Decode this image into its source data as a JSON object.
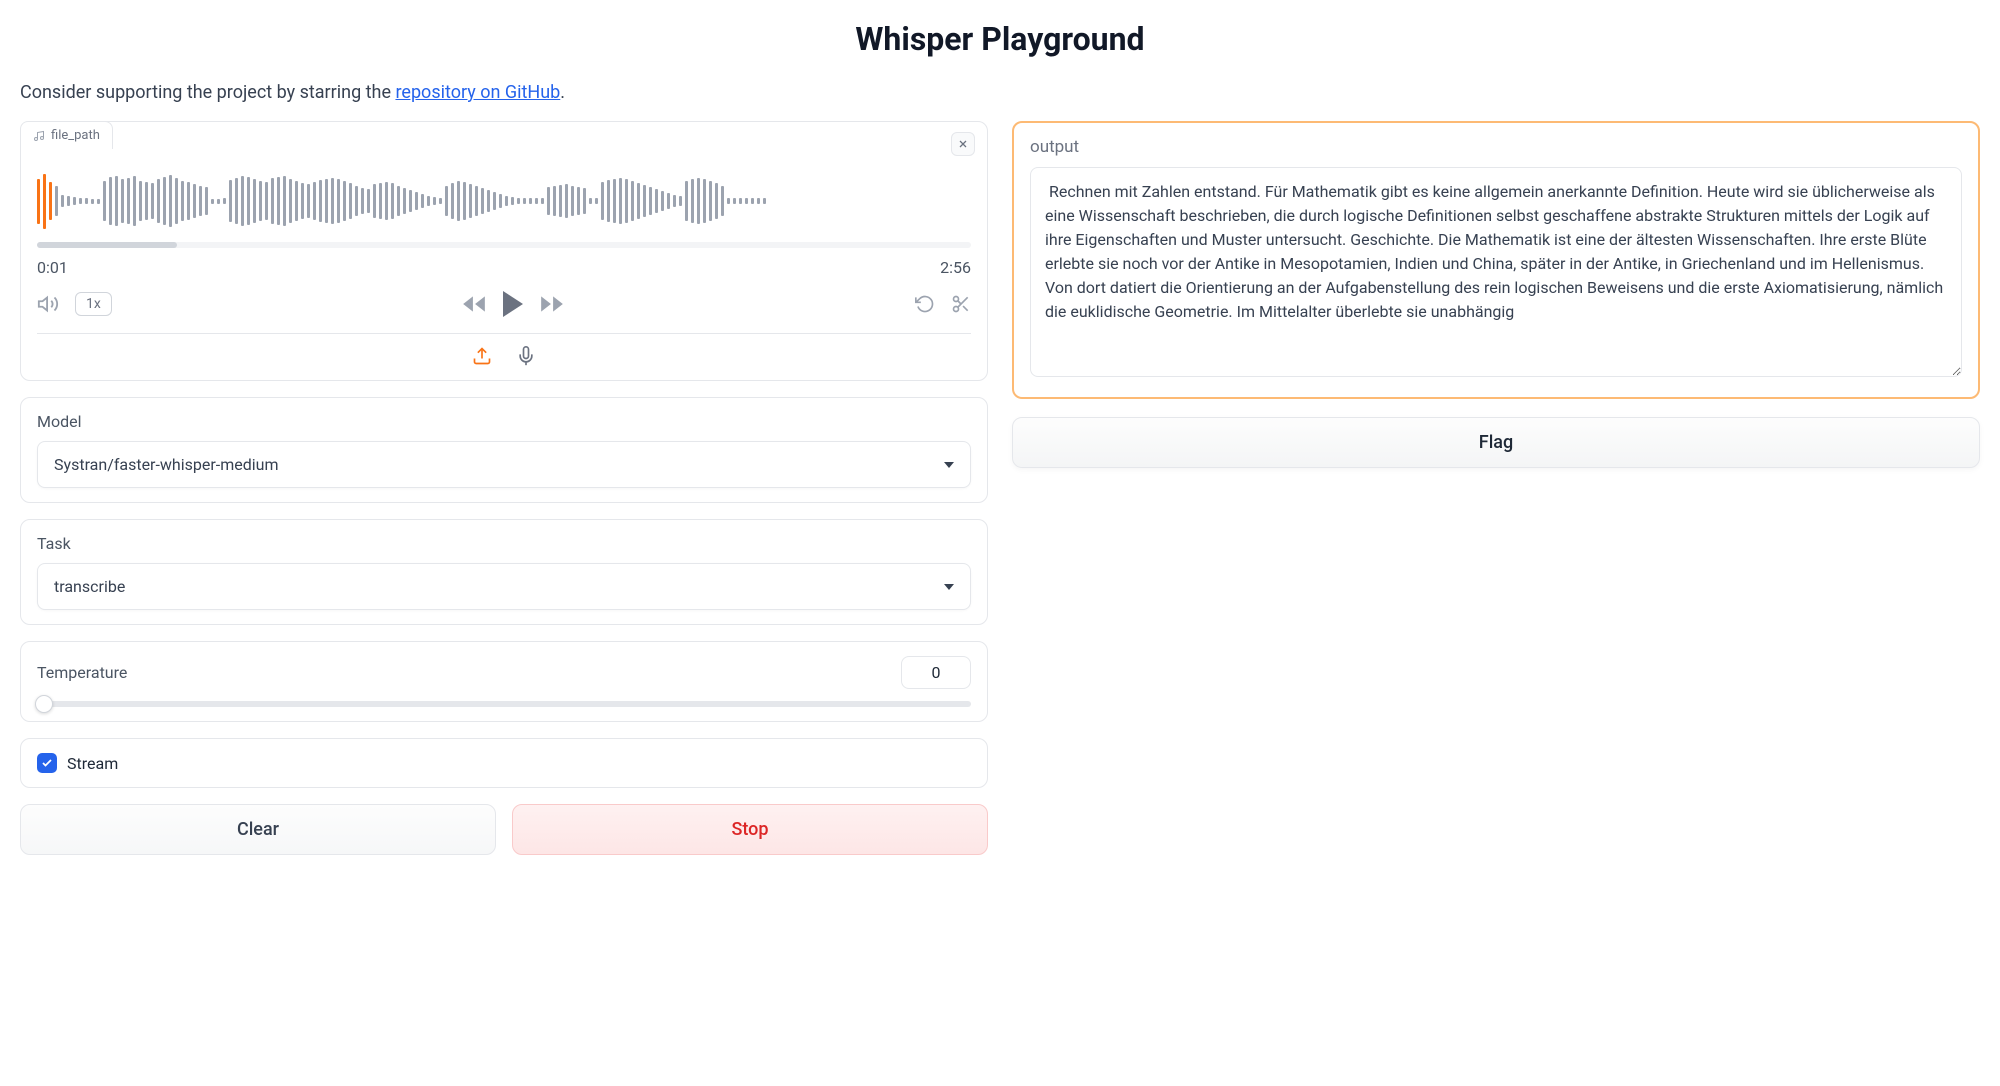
{
  "title": "Whisper Playground",
  "support": {
    "prefix": "Consider supporting the project by starring the ",
    "link_text": "repository on GitHub",
    "suffix": "."
  },
  "audio": {
    "file_label": "file_path",
    "current_time": "0:01",
    "total_time": "2:56",
    "speed": "1x"
  },
  "model": {
    "label": "Model",
    "value": "Systran/faster-whisper-medium"
  },
  "task": {
    "label": "Task",
    "value": "transcribe"
  },
  "temperature": {
    "label": "Temperature",
    "value": "0"
  },
  "stream": {
    "label": "Stream",
    "checked": true
  },
  "buttons": {
    "clear": "Clear",
    "stop": "Stop",
    "flag": "Flag"
  },
  "output": {
    "label": "output",
    "text": " Rechnen mit Zahlen entstand. Für Mathematik gibt es keine allgemein anerkannte Definition. Heute wird sie üblicherweise als eine Wissenschaft beschrieben, die durch logische Definitionen selbst geschaffene abstrakte Strukturen mittels der Logik auf ihre Eigenschaften und Muster untersucht. Geschichte. Die Mathematik ist eine der ältesten Wissenschaften. Ihre erste Blüte erlebte sie noch vor der Antike in Mesopotamien, Indien und China, später in der Antike, in Griechenland und im Hellenismus. Von dort datiert die Orientierung an der Aufgabenstellung des rein logischen Beweisens und die erste Axiomatisierung, nämlich die euklidische Geometrie. Im Mittelalter überlebte sie unabhängig"
  }
}
